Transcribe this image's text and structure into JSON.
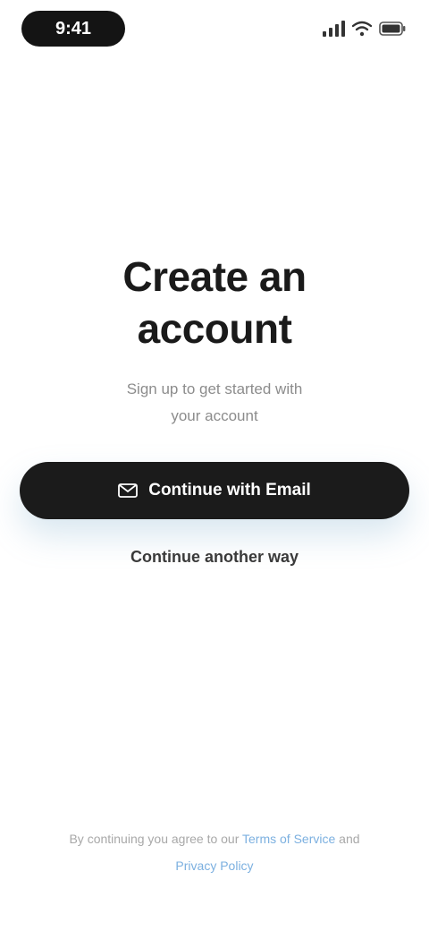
{
  "status_bar": {
    "time": "9:41"
  },
  "header": {
    "title_line1": "Create an",
    "title_line2": "account"
  },
  "subtitle": {
    "line1": "Sign up to get started with",
    "line2": "your account"
  },
  "primary_action": {
    "label": "Continue with Email",
    "icon": "mail-icon"
  },
  "secondary_action": {
    "label": "Continue another way"
  },
  "terms": {
    "prefix": "By continuing you agree to our ",
    "terms_link": "Terms of Service",
    "middle": " and ",
    "privacy_link": "Privacy Policy"
  },
  "colors": {
    "background": "#ffffff",
    "button": "#1b1b1b",
    "link": "#7cb0e0",
    "muted_text": "#8c8c8c"
  }
}
